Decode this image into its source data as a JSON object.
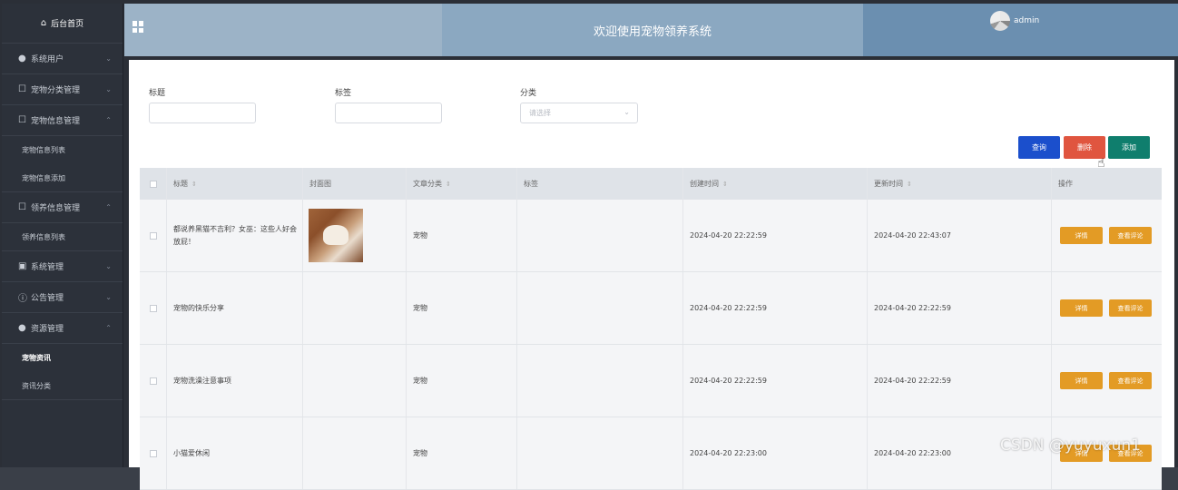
{
  "sidebar": {
    "home": "后台首页",
    "items": [
      {
        "label": "系统用户",
        "icon": "user-icon",
        "chev": "⌄"
      },
      {
        "label": "宠物分类管理",
        "icon": "edit-icon",
        "chev": "⌄"
      },
      {
        "label": "宠物信息管理",
        "icon": "edit-icon",
        "chev": "⌃",
        "sub": [
          "宠物信息列表",
          "宠物信息添加"
        ]
      },
      {
        "label": "领养信息管理",
        "icon": "edit-icon",
        "chev": "⌃",
        "sub": [
          "领养信息列表"
        ]
      },
      {
        "label": "系统管理",
        "icon": "chart-icon",
        "chev": "⌄"
      },
      {
        "label": "公告管理",
        "icon": "info-icon",
        "chev": "⌄"
      },
      {
        "label": "资源管理",
        "icon": "location-icon",
        "chev": "⌃",
        "sub": [
          "宠物资讯",
          "资讯分类"
        ]
      }
    ]
  },
  "header": {
    "title": "欢迎使用宠物领养系统",
    "user": "admin"
  },
  "filters": {
    "title_label": "标题",
    "tag_label": "标签",
    "category_label": "分类",
    "category_placeholder": "请选择"
  },
  "buttons": {
    "query": "查询",
    "delete": "删除",
    "add": "添加"
  },
  "table": {
    "columns": [
      "标题",
      "封面图",
      "文章分类",
      "标签",
      "创建时间",
      "更新时间",
      "操作"
    ],
    "rows": [
      {
        "title": "都说养黑猫不吉利？女巫：这些人好会放屁！",
        "category": "宠物",
        "tag": "",
        "created": "2024-04-20 22:22:59",
        "updated": "2024-04-20 22:43:07",
        "has_image": true
      },
      {
        "title": "宠物的快乐分享",
        "category": "宠物",
        "tag": "",
        "created": "2024-04-20 22:22:59",
        "updated": "2024-04-20 22:22:59",
        "has_image": false
      },
      {
        "title": "宠物洗澡注意事项",
        "category": "宠物",
        "tag": "",
        "created": "2024-04-20 22:22:59",
        "updated": "2024-04-20 22:22:59",
        "has_image": false
      },
      {
        "title": "小猫爱休闲",
        "category": "宠物",
        "tag": "",
        "created": "2024-04-20 22:23:00",
        "updated": "2024-04-20 22:23:00",
        "has_image": false
      }
    ],
    "action_detail": "详情",
    "action_comment": "查看评论"
  },
  "watermark": "CSDN @yuyuxun1"
}
